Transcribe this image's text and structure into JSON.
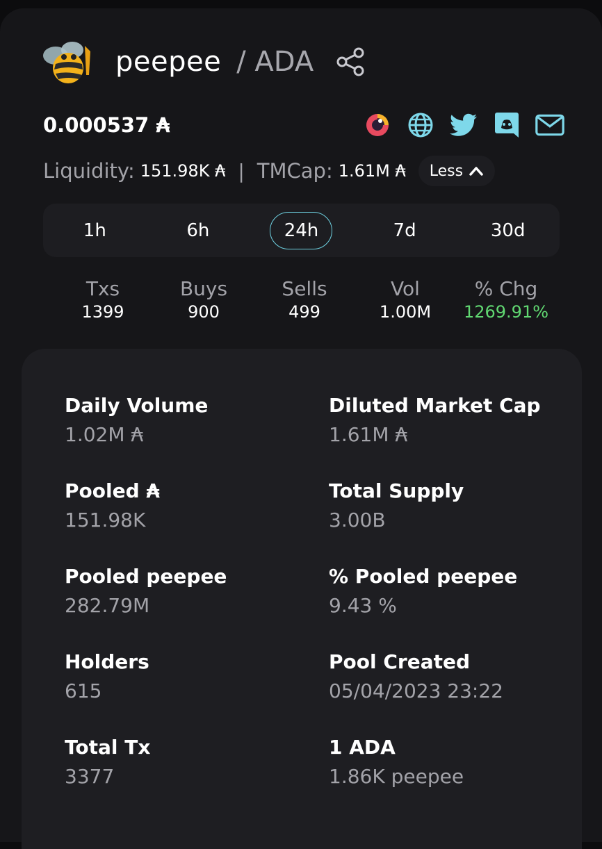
{
  "token": {
    "name": "peepee",
    "pair": "/ ADA",
    "price": "0.000537 ₳"
  },
  "socials": [
    "coingecko-icon",
    "globe-icon",
    "twitter-icon",
    "discord-icon",
    "mail-icon"
  ],
  "liquidity": {
    "liquidity_label": "Liquidity:",
    "liquidity_value": "151.98K ₳",
    "divider": "|",
    "tmcap_label": "TMCap:",
    "tmcap_value": "1.61M ₳",
    "less_label": "Less"
  },
  "tabs": [
    {
      "label": "1h"
    },
    {
      "label": "6h"
    },
    {
      "label": "24h",
      "active": true
    },
    {
      "label": "7d"
    },
    {
      "label": "30d"
    }
  ],
  "stats": [
    {
      "label": "Txs",
      "value": "1399"
    },
    {
      "label": "Buys",
      "value": "900"
    },
    {
      "label": "Sells",
      "value": "499"
    },
    {
      "label": "Vol",
      "value": "1.00M"
    },
    {
      "label": "% Chg",
      "value": "1269.91%"
    }
  ],
  "details": [
    {
      "label": "Daily Volume",
      "value": "1.02M ₳"
    },
    {
      "label": "Diluted Market Cap",
      "value": "1.61M ₳"
    },
    {
      "label": "Pooled ₳",
      "value": "151.98K"
    },
    {
      "label": "Total Supply",
      "value": "3.00B"
    },
    {
      "label": "Pooled peepee",
      "value": "282.79M"
    },
    {
      "label": "% Pooled peepee",
      "value": "9.43 %"
    },
    {
      "label": "Holders",
      "value": "615"
    },
    {
      "label": "Pool Created",
      "value": "05/04/2023 23:22"
    },
    {
      "label": "Total Tx",
      "value": "3377"
    },
    {
      "label": "1 ADA",
      "value": "1.86K peepee"
    }
  ],
  "colors": {
    "accent": "#6fd2e2",
    "positive": "#61d972",
    "social": "#7ed8ea"
  }
}
